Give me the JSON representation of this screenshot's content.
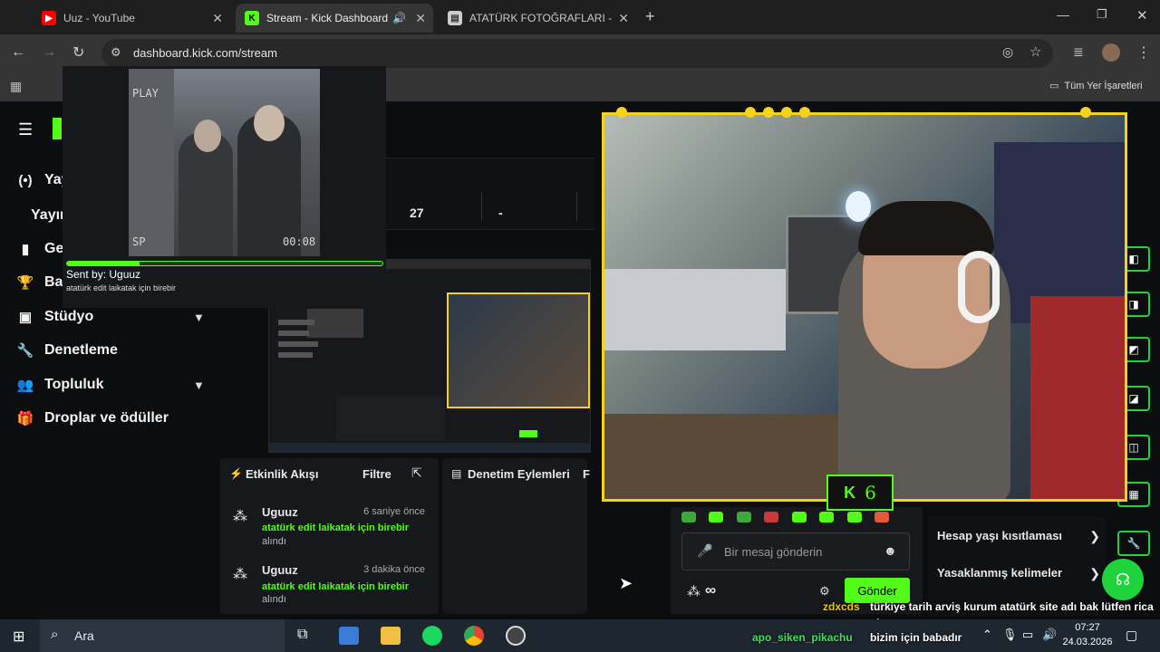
{
  "browser": {
    "tabs": [
      {
        "title": "Uuz - YouTube",
        "active": false
      },
      {
        "title": "Stream - Kick Dashboard",
        "active": true
      },
      {
        "title": "ATATÜRK FOTOĞRAFLARI - Atat",
        "active": false
      }
    ],
    "url": "dashboard.kick.com/stream",
    "bookmarks_label": "Tüm Yer İşaretleri"
  },
  "sidebar": {
    "items": [
      {
        "label": "Yay"
      },
      {
        "label": "Yayır"
      },
      {
        "label": "Ge"
      },
      {
        "label": "Ba"
      },
      {
        "label": "Stüdyo"
      },
      {
        "label": "Denetleme"
      },
      {
        "label": "Topluluk"
      },
      {
        "label": "Droplar ve ödüller"
      }
    ]
  },
  "stats": {
    "value1": "27",
    "value2": "-"
  },
  "alert": {
    "video_play_text": "PLAY",
    "video_sp_text": "SP",
    "video_time": "00:08",
    "progress": 0.23,
    "sender": "Sent by: Uguuz",
    "message": "atatürk edit laikatak için birebir"
  },
  "activity": {
    "title": "Etkinlik Akışı",
    "filter": "Filtre",
    "events": [
      {
        "user": "Uguuz",
        "time": "6 saniye önce",
        "reward": "atatürk edit laikatak için birebir",
        "status": "alındı"
      },
      {
        "user": "Uguuz",
        "time": "3 dakika önce",
        "reward": "atatürk edit laikatak için birebir",
        "status": "alındı"
      }
    ]
  },
  "moderation": {
    "title": "Denetim Eylemleri",
    "f": "F"
  },
  "chat": {
    "placeholder": "Bir mesaj gönderin",
    "infinity": "∞",
    "send": "Gönder"
  },
  "settings_panel": {
    "item1": "Hesap yaşı kısıtlaması",
    "item2": "Yasaklanmış kelimeler"
  },
  "webcam": {
    "badge": "6"
  },
  "overlay_chat": [
    {
      "user": "zdxcds",
      "user_color": "#f0c400",
      "text": "türkiye tarih arviş kurum atatürk site adı bak lütfen rica etsem"
    },
    {
      "user": "apo_siken_pikachu",
      "user_color": "#3ee05a",
      "text": "bizim için babadır"
    }
  ],
  "taskbar": {
    "search": "Ara",
    "time": "07:27",
    "date": "24.03.2026"
  },
  "colors": {
    "kick_green": "#53fc18",
    "accent_green": "#1fd33d",
    "frame_yellow": "#f5d31c"
  }
}
